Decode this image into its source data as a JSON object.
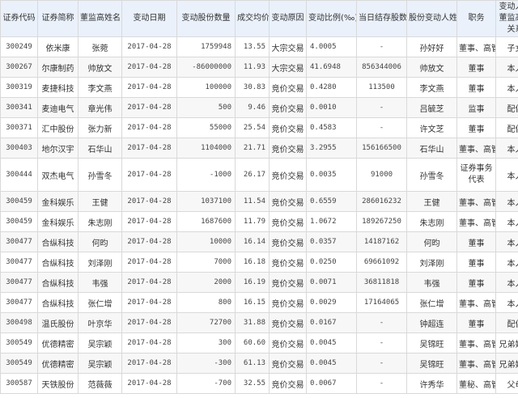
{
  "table": {
    "headers": [
      "证券代码",
      "证券简称",
      "董监高姓名",
      "变动日期",
      "变动股份数量",
      "成交均价",
      "变动原因",
      "变动比例(‰)",
      "当日结存股数",
      "股份变动人姓名",
      "职务",
      "变动人与董监高的关系"
    ],
    "rows": [
      [
        "300249",
        "依米康",
        "张菀",
        "2017-04-28",
        "1759948",
        "13.55",
        "大宗交易",
        "4.0005",
        "-",
        "孙好好",
        "董事、高管",
        "子女"
      ],
      [
        "300267",
        "尔康制药",
        "帅放文",
        "2017-04-28",
        "-86000000",
        "11.93",
        "大宗交易",
        "41.6948",
        "856344006",
        "帅放文",
        "董事",
        "本人"
      ],
      [
        "300319",
        "麦捷科技",
        "李文燕",
        "2017-04-28",
        "100000",
        "30.83",
        "竞价交易",
        "0.4280",
        "113500",
        "李文燕",
        "董事",
        "本人"
      ],
      [
        "300341",
        "麦迪电气",
        "章光伟",
        "2017-04-28",
        "500",
        "9.46",
        "竞价交易",
        "0.0010",
        "-",
        "吕毓芝",
        "监事",
        "配偶"
      ],
      [
        "300371",
        "汇中股份",
        "张力新",
        "2017-04-28",
        "55000",
        "25.54",
        "竞价交易",
        "0.4583",
        "-",
        "许文芝",
        "董事",
        "配偶"
      ],
      [
        "300403",
        "地尔汉宇",
        "石华山",
        "2017-04-28",
        "1104000",
        "21.71",
        "竞价交易",
        "3.2955",
        "156166500",
        "石华山",
        "董事、高管",
        "本人"
      ],
      [
        "300444",
        "双杰电气",
        "孙雪冬",
        "2017-04-28",
        "-1000",
        "26.17",
        "竞价交易",
        "0.0035",
        "91000",
        "孙雪冬",
        "证券事务代表",
        "本人"
      ],
      [
        "300459",
        "金科娱乐",
        "王健",
        "2017-04-28",
        "1037100",
        "11.54",
        "竞价交易",
        "0.6559",
        "286016232",
        "王健",
        "董事、高管",
        "本人"
      ],
      [
        "300459",
        "金科娱乐",
        "朱志刚",
        "2017-04-28",
        "1687600",
        "11.79",
        "竞价交易",
        "1.0672",
        "189267250",
        "朱志刚",
        "董事、高管",
        "本人"
      ],
      [
        "300477",
        "合纵科技",
        "何昀",
        "2017-04-28",
        "10000",
        "16.14",
        "竞价交易",
        "0.0357",
        "14187162",
        "何昀",
        "董事",
        "本人"
      ],
      [
        "300477",
        "合纵科技",
        "刘泽刚",
        "2017-04-28",
        "7000",
        "16.18",
        "竞价交易",
        "0.0250",
        "69661092",
        "刘泽刚",
        "董事",
        "本人"
      ],
      [
        "300477",
        "合纵科技",
        "韦强",
        "2017-04-28",
        "2000",
        "16.19",
        "竞价交易",
        "0.0071",
        "36811818",
        "韦强",
        "董事",
        "本人"
      ],
      [
        "300477",
        "合纵科技",
        "张仁增",
        "2017-04-28",
        "800",
        "16.15",
        "竞价交易",
        "0.0029",
        "17164065",
        "张仁增",
        "董事、高管",
        "本人"
      ],
      [
        "300498",
        "温氏股份",
        "叶京华",
        "2017-04-28",
        "72700",
        "31.88",
        "竞价交易",
        "0.0167",
        "-",
        "钟超连",
        "董事",
        "配偶"
      ],
      [
        "300549",
        "优德精密",
        "吴宗颖",
        "2017-04-28",
        "300",
        "60.60",
        "竞价交易",
        "0.0045",
        "-",
        "吴锦旺",
        "董事、高管",
        "兄弟姐妹"
      ],
      [
        "300549",
        "优德精密",
        "吴宗颖",
        "2017-04-28",
        "-300",
        "61.13",
        "竞价交易",
        "0.0045",
        "-",
        "吴锦旺",
        "董事、高管",
        "兄弟姐妹"
      ],
      [
        "300587",
        "天铁股份",
        "范薇薇",
        "2017-04-28",
        "-700",
        "32.55",
        "竞价交易",
        "0.0067",
        "-",
        "许秀华",
        "董秘、高管",
        "父母"
      ]
    ]
  }
}
